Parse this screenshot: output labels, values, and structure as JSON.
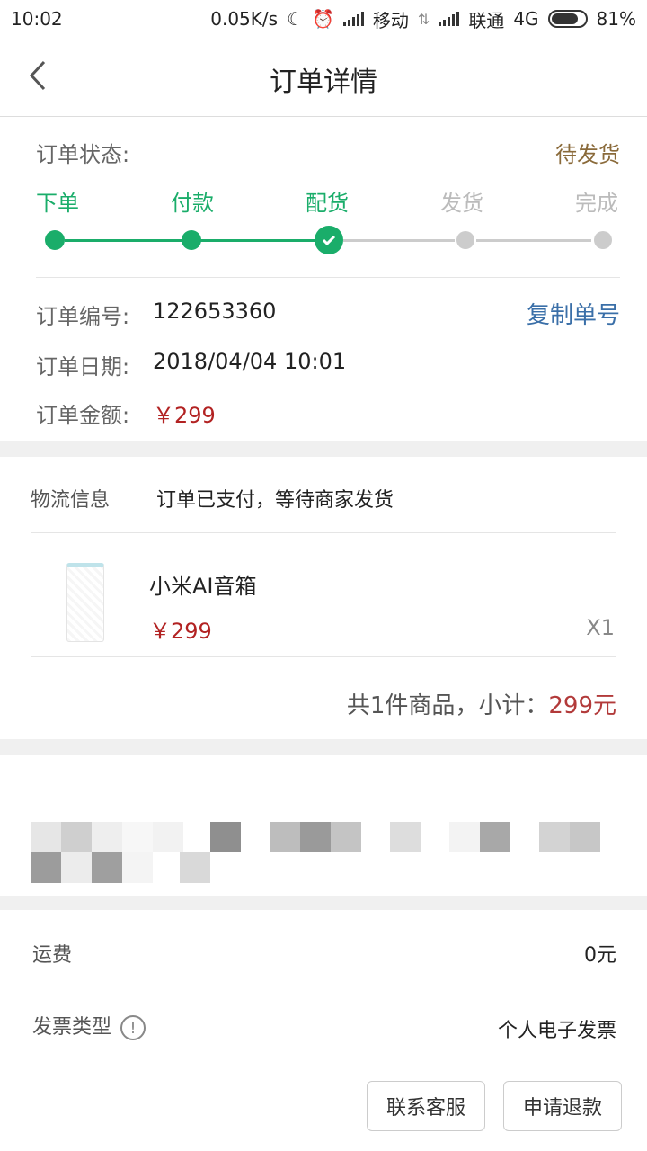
{
  "status_bar": {
    "time": "10:02",
    "speed": "0.05K/s",
    "carrier1": "移动",
    "carrier2": "联通",
    "network": "4G",
    "battery": "81%",
    "battery_level": 0.81
  },
  "nav": {
    "title": "订单详情"
  },
  "order": {
    "status_label": "订单状态:",
    "status_value": "待发货",
    "steps": [
      {
        "label": "下单",
        "state": "done"
      },
      {
        "label": "付款",
        "state": "done"
      },
      {
        "label": "配货",
        "state": "current"
      },
      {
        "label": "发货",
        "state": "todo"
      },
      {
        "label": "完成",
        "state": "todo"
      }
    ],
    "number_label": "订单编号:",
    "number_value": "122653360",
    "copy_label": "复制单号",
    "date_label": "订单日期:",
    "date_value": "2018/04/04 10:01",
    "amount_label": "订单金额:",
    "amount_value": "￥299"
  },
  "logistics": {
    "label": "物流信息",
    "value": "订单已支付，等待商家发货"
  },
  "product": {
    "name": "小米AI音箱",
    "price": "￥299",
    "qty": "X1"
  },
  "subtotal": {
    "prefix": "共1件商品，小计：",
    "amount": "299元"
  },
  "fees": {
    "shipping_label": "运费",
    "shipping_value": "0元",
    "invoice_label": "发票类型",
    "invoice_value": "个人电子发票"
  },
  "buttons": {
    "contact": "联系客服",
    "refund": "申请退款"
  },
  "colors": {
    "accent_green": "#1aad6a",
    "price_red": "#b22222",
    "link_blue": "#3a6fa8",
    "status_brown": "#8a6a3a"
  }
}
